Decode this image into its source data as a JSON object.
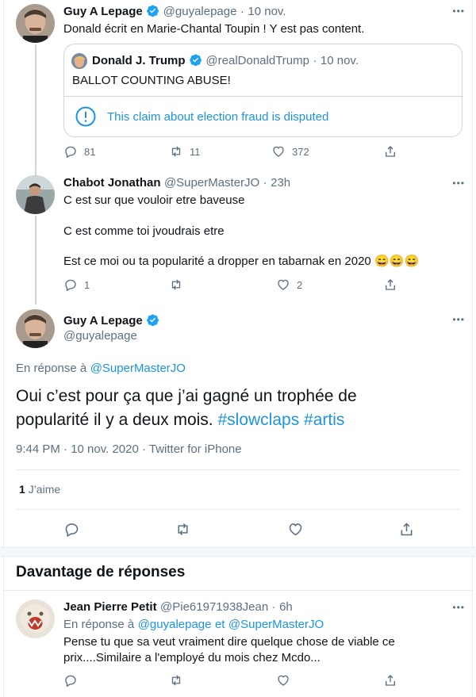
{
  "tweet1": {
    "name": "Guy A Lepage",
    "handle": "@guyalepage",
    "sep": "·",
    "time": "10 nov.",
    "text": "Donald écrit en Marie-Chantal Toupin ! Y est pas content.",
    "quote": {
      "name": "Donald J. Trump",
      "handle": "@realDonaldTrump",
      "sep": "·",
      "time": "10 nov.",
      "text": "BALLOT COUNTING ABUSE!",
      "disputed": "This claim about election fraud is disputed"
    },
    "replies": "81",
    "retweets": "11",
    "likes": "372"
  },
  "tweet2": {
    "name": "Chabot Jonathan",
    "handle": "@SuperMasterJO",
    "sep": "·",
    "time": "23h",
    "line1": "C est sur que vouloir etre baveuse",
    "line2": "C est comme toi jvoudrais etre",
    "line3": "Est ce moi ou ta popularité a dropper en tabarnak en 2020",
    "emoji": "😄😄😄",
    "replies": "1",
    "likes": "2"
  },
  "main": {
    "name": "Guy A Lepage",
    "handle": "@guyalepage",
    "reply_to_label": "En réponse à",
    "reply_to_handle": "@SuperMasterJO",
    "text_line1": "Oui c’est pour ça que j’ai gagné un trophée de",
    "text_line2_plain": "popularité il y a deux mois.",
    "hashtag1": "#slowclaps",
    "hashtag2": "#artis",
    "meta": "9:44 PM · 10 nov. 2020 · Twitter for iPhone",
    "likes_count": "1",
    "likes_label": "J’aime"
  },
  "more_replies": {
    "heading": "Davantage de réponses"
  },
  "tweet3": {
    "name": "Jean Pierre Petit",
    "handle": "@Pie61971938Jean",
    "sep": "·",
    "time": "6h",
    "reply_to_label": "En réponse à",
    "reply_to_1": "@guyalepage",
    "reply_to_and": "et",
    "reply_to_2": "@SuperMasterJO",
    "line1": "Pense tu que sa veut vraiment dire quelque chose de viable ce",
    "line2": "prix....Similaire a l'employé du mois chez Mcdo..."
  },
  "colors": {
    "accent": "#1b95e0",
    "muted": "#5b7083",
    "border": "#e6ecf0",
    "verified": "#1da1f2"
  },
  "more_icon": "•••"
}
